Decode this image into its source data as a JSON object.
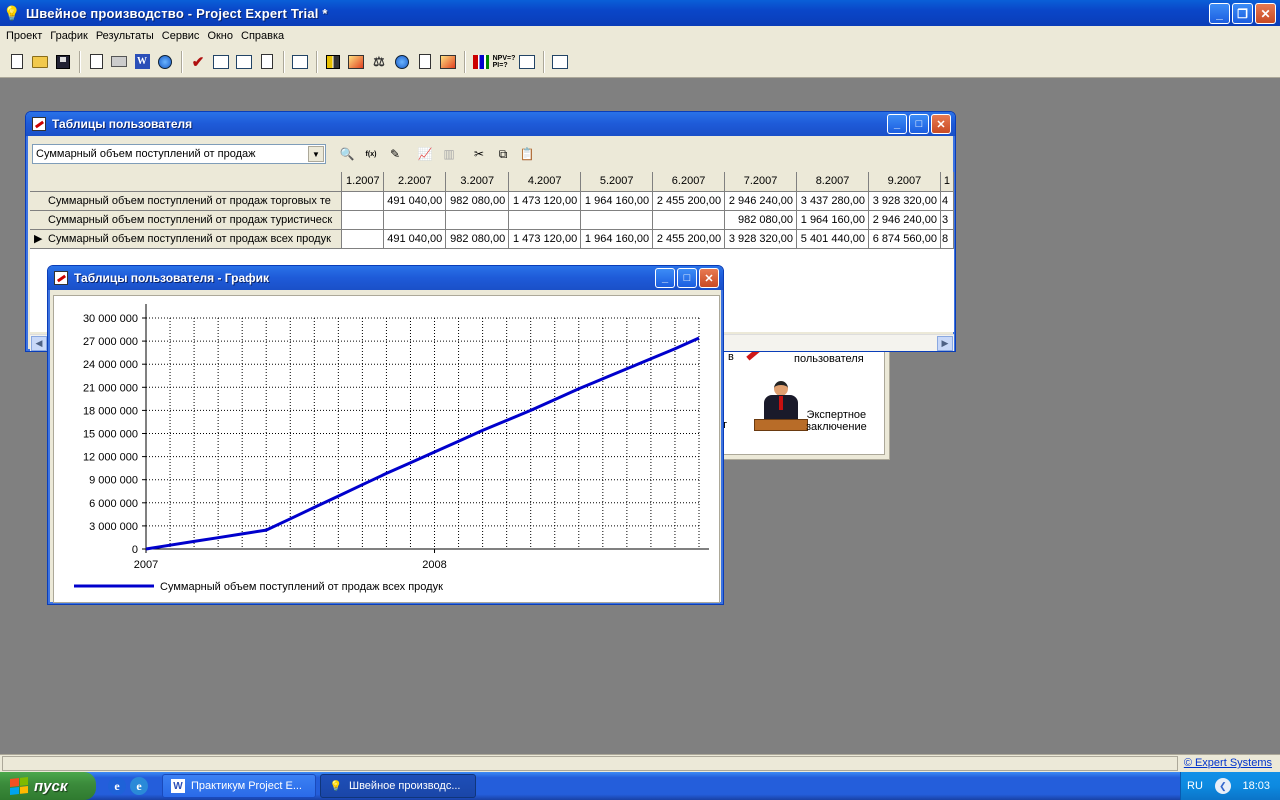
{
  "app": {
    "title": "Швейное производство - Project Expert Trial *"
  },
  "menu": [
    "Проект",
    "График",
    "Результаты",
    "Сервис",
    "Окно",
    "Справка"
  ],
  "project_panel": {
    "label_user": "пользователя",
    "label_expert": "Экспертное\nзаключение",
    "label_cut_left1": "в",
    "label_cut_left2": "т"
  },
  "table_window": {
    "title": "Таблицы пользователя",
    "combo_value": "Суммарный объем поступлений от продаж",
    "columns": [
      "1.2007",
      "2.2007",
      "3.2007",
      "4.2007",
      "5.2007",
      "6.2007",
      "7.2007",
      "8.2007",
      "9.2007",
      "1"
    ],
    "rows": [
      {
        "name": "Суммарный объем поступлений от продаж торговых те",
        "values": [
          "",
          "491 040,00",
          "982 080,00",
          "1 473 120,00",
          "1 964 160,00",
          "2 455 200,00",
          "2 946 240,00",
          "3 437 280,00",
          "3 928 320,00",
          "4"
        ]
      },
      {
        "name": "Суммарный объем поступлений от продаж туристическ",
        "values": [
          "",
          "",
          "",
          "",
          "",
          "",
          "982 080,00",
          "1 964 160,00",
          "2 946 240,00",
          "3"
        ]
      },
      {
        "name": "Суммарный объем поступлений от продаж всех продук",
        "values": [
          "",
          "491 040,00",
          "982 080,00",
          "1 473 120,00",
          "1 964 160,00",
          "2 455 200,00",
          "3 928 320,00",
          "5 401 440,00",
          "6 874 560,00",
          "8"
        ],
        "current": true
      }
    ]
  },
  "chart_window": {
    "title": "Таблицы пользователя - График"
  },
  "chart_data": {
    "type": "line",
    "title": "",
    "xlabel": "",
    "ylabel": "",
    "ylim": [
      0,
      30000000
    ],
    "yticks": [
      0,
      3000000,
      6000000,
      9000000,
      12000000,
      15000000,
      18000000,
      21000000,
      24000000,
      27000000,
      30000000
    ],
    "ytick_labels": [
      "0",
      "3 000 000",
      "6 000 000",
      "9 000 000",
      "12 000 000",
      "15 000 000",
      "18 000 000",
      "21 000 000",
      "24 000 000",
      "27 000 000",
      "30 000 000"
    ],
    "xlim": [
      "2007-01",
      "2008-11"
    ],
    "xtick_labels": [
      "2007",
      "2008"
    ],
    "xticks": [
      "2007-01",
      "2008-01"
    ],
    "grid": true,
    "legend": "bottom-left",
    "series": [
      {
        "name": "Суммарный объем поступлений от продаж всех продук",
        "color": "#0000cc",
        "points": [
          {
            "x": "2007-01",
            "y": 0
          },
          {
            "x": "2007-02",
            "y": 491040
          },
          {
            "x": "2007-03",
            "y": 982080
          },
          {
            "x": "2007-04",
            "y": 1473120
          },
          {
            "x": "2007-05",
            "y": 1964160
          },
          {
            "x": "2007-06",
            "y": 2455200
          },
          {
            "x": "2007-07",
            "y": 3928320
          },
          {
            "x": "2007-08",
            "y": 5401440
          },
          {
            "x": "2007-09",
            "y": 6874560
          },
          {
            "x": "2007-10",
            "y": 8347680
          },
          {
            "x": "2007-11",
            "y": 9820800
          },
          {
            "x": "2007-12",
            "y": 11200000
          },
          {
            "x": "2008-01",
            "y": 12600000
          },
          {
            "x": "2008-02",
            "y": 14000000
          },
          {
            "x": "2008-03",
            "y": 15400000
          },
          {
            "x": "2008-04",
            "y": 16700000
          },
          {
            "x": "2008-05",
            "y": 18000000
          },
          {
            "x": "2008-06",
            "y": 19400000
          },
          {
            "x": "2008-07",
            "y": 20800000
          },
          {
            "x": "2008-08",
            "y": 22100000
          },
          {
            "x": "2008-09",
            "y": 23400000
          },
          {
            "x": "2008-10",
            "y": 24700000
          },
          {
            "x": "2008-11",
            "y": 26000000
          },
          {
            "x": "2008-12",
            "y": 27400000
          }
        ]
      }
    ]
  },
  "status": {
    "link": "© Expert Systems"
  },
  "taskbar": {
    "start": "пуск",
    "tasks": [
      "Практикум Project E...",
      "Швейное производс..."
    ],
    "lang": "RU",
    "clock": "18:03"
  },
  "colors": {
    "titlebar": "#0a46c8",
    "desktop": "#808080",
    "series": "#0000cc"
  }
}
